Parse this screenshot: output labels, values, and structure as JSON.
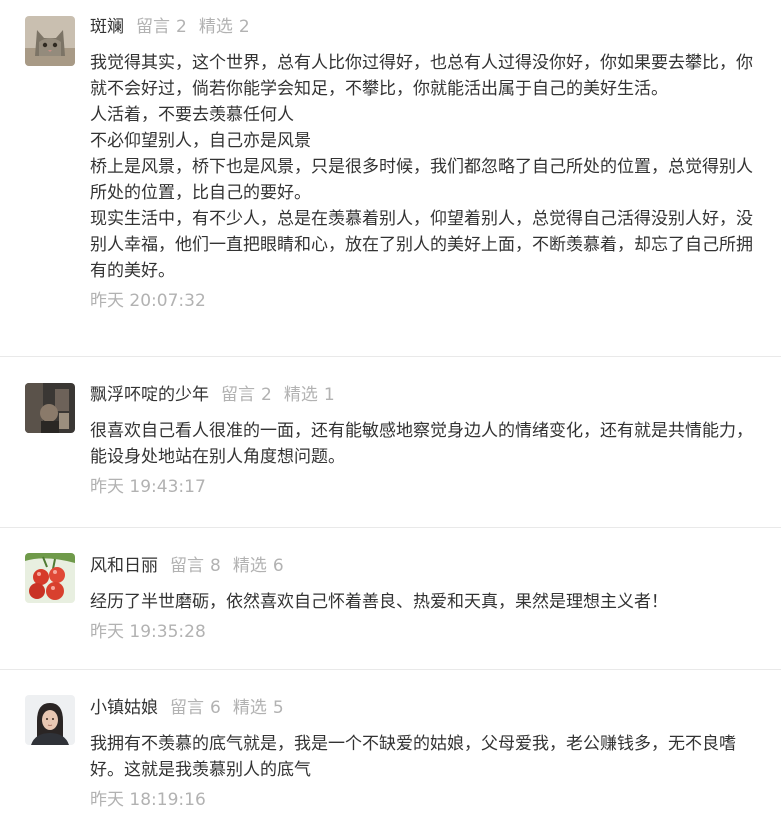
{
  "comments": [
    {
      "username": "斑斓",
      "reply_label": "留言",
      "reply_count": "2",
      "featured_label": "精选",
      "featured_count": "2",
      "avatar_icon": "cat-avatar-icon",
      "paragraphs": [
        "我觉得其实，这个世界，总有人比你过得好，也总有人过得没你好，你如果要去攀比，你就不会好过，倘若你能学会知足，不攀比，你就能活出属于自己的美好生活。",
        "人活着，不要去羡慕任何人",
        "不必仰望别人，自己亦是风景",
        "桥上是风景，桥下也是风景，只是很多时候，我们都忽略了自己所处的位置，总觉得别人所处的位置，比自己的要好。",
        "现实生活中，有不少人，总是在羡慕着别人，仰望着别人，总觉得自己活得没别人好，没别人幸福，他们一直把眼睛和心，放在了别人的美好上面，不断羡慕着，却忘了自己所拥有的美好。"
      ],
      "time": "昨天 20:07:32"
    },
    {
      "username": "飘浮吥啶的少年",
      "reply_label": "留言",
      "reply_count": "2",
      "featured_label": "精选",
      "featured_count": "1",
      "avatar_icon": "dark-photo-avatar-icon",
      "paragraphs": [
        "很喜欢自己看人很准的一面，还有能敏感地察觉身边人的情绪变化，还有就是共情能力，能设身处地站在别人角度想问题。"
      ],
      "time": "昨天 19:43:17"
    },
    {
      "username": "风和日丽",
      "reply_label": "留言",
      "reply_count": "8",
      "featured_label": "精选",
      "featured_count": "6",
      "avatar_icon": "red-berries-avatar-icon",
      "paragraphs": [
        "经历了半世磨砺，依然喜欢自己怀着善良、热爱和天真，果然是理想主义者！"
      ],
      "time": "昨天 19:35:28"
    },
    {
      "username": "小镇姑娘",
      "reply_label": "留言",
      "reply_count": "6",
      "featured_label": "精选",
      "featured_count": "5",
      "avatar_icon": "woman-portrait-avatar-icon",
      "paragraphs": [
        "我拥有不羡慕的底气就是，我是一个不缺爱的姑娘，父母爱我，老公赚钱多，无不良嗜好。这就是我羡慕别人的底气"
      ],
      "time": "昨天 18:19:16"
    }
  ]
}
